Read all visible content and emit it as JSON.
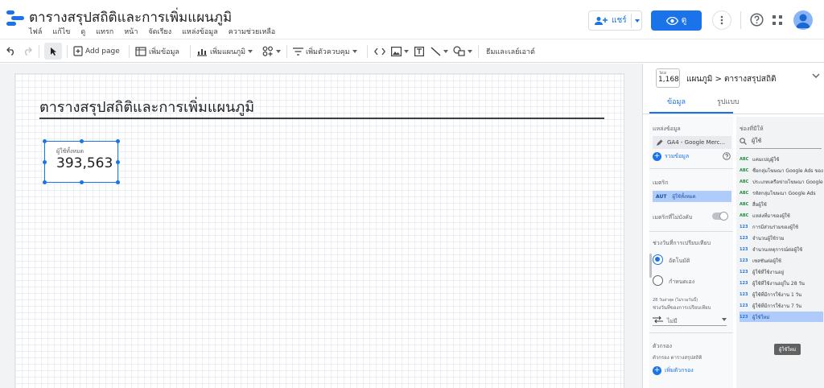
{
  "app": {
    "title": "ตารางสรุปสถิติและการเพิ่มแผนภูมิ",
    "menu": [
      "ไฟล์",
      "แก้ไข",
      "ดู",
      "แทรก",
      "หน้า",
      "จัดเรียง",
      "แหล่งข้อมูล",
      "ความช่วยเหลือ"
    ],
    "share_label": "แชร์",
    "view_label": "ดู",
    "brand_color": "#1a73e8"
  },
  "toolbar": {
    "add_page": "Add page",
    "add_data": "เพิ่มข้อมูล",
    "add_chart": "เพิ่มแผนภูมิ",
    "add_control": "เพิ่มตัวควบคุม",
    "theme_layout": "ธีมและเลย์เอาต์"
  },
  "canvas": {
    "report_title": "ตารางสรุปสถิติและการเพิ่มแผนภูมิ",
    "scorecard": {
      "label": "ผู้ใช้ทั้งหมด",
      "value": "393,563"
    }
  },
  "panel": {
    "thumb_label": "Total",
    "thumb_value": "1,168",
    "breadcrumb": "แผนภูมิ > ตารางสรุปสถิติ",
    "tabs": [
      "ข้อมูล",
      "รูปแบบ"
    ],
    "data": {
      "source_label": "แหล่งข้อมูล",
      "source_name": "GA4 - Google Merc...",
      "blend_label": "รวมข้อมูล",
      "metric_label": "เมตริก",
      "metric_type": "AUT",
      "metric_name": "ผู้ใช้ทั้งหมด",
      "optional_metric_label": "เมตริกที่ไม่บังคับ",
      "compare_label": "ช่วงวันที่การเปรียบเทียบ",
      "auto_label": "อัตโนมัติ",
      "custom_label": "กำหนดเอง",
      "hint": "28 วันล่าสุด (ไม่รวมวันนี้)",
      "compare_period": "ช่วงวันที่ของการเปรียบเทียบ",
      "none_label": "ไม่มี",
      "filter_label": "ตัวกรอง",
      "filter_sub": "ตัวกรอง ตารางสรุปสถิติ",
      "add_filter": "เพิ่มตัวกรอง"
    },
    "fields": {
      "header": "ช่องที่มีให้",
      "search_value": "ผู้ใช้",
      "items": [
        {
          "type": "ABC",
          "name": "แคมเปญผู้ใช้",
          "selected": false
        },
        {
          "type": "ABC",
          "name": "ชื่อกลุ่มโฆษณา Google Ads ของผู้ใช้",
          "selected": false
        },
        {
          "type": "ABC",
          "name": "ประเภทเครือข่ายโฆษณา Google Ads",
          "selected": false
        },
        {
          "type": "ABC",
          "name": "รหัสกลุ่มโฆษณา Google Ads",
          "selected": false
        },
        {
          "type": "ABC",
          "name": "สื่อผู้ใช้",
          "selected": false
        },
        {
          "type": "ABC",
          "name": "แหล่งที่มาของผู้ใช้",
          "selected": false
        },
        {
          "type": "123",
          "name": "การมีส่วนร่วมของผู้ใช้",
          "selected": false
        },
        {
          "type": "123",
          "name": "จำนวนผู้ใช้รวม",
          "selected": false
        },
        {
          "type": "123",
          "name": "จำนวนเหตุการณ์ต่อผู้ใช้",
          "selected": false
        },
        {
          "type": "123",
          "name": "เซสชันต่อผู้ใช้",
          "selected": false
        },
        {
          "type": "123",
          "name": "ผู้ใช้ที่ใช้งานอยู่",
          "selected": false
        },
        {
          "type": "123",
          "name": "ผู้ใช้ที่ใช้งานอยู่ใน 28 วัน",
          "selected": false
        },
        {
          "type": "123",
          "name": "ผู้ใช้ที่มีการใช้งาน 1 วัน",
          "selected": false
        },
        {
          "type": "123",
          "name": "ผู้ใช้ที่มีการใช้งาน 7 วัน",
          "selected": false
        },
        {
          "type": "123",
          "name": "ผู้ใช้ใหม่",
          "selected": true
        }
      ],
      "tooltip": "ผู้ใช้ใหม่"
    }
  }
}
